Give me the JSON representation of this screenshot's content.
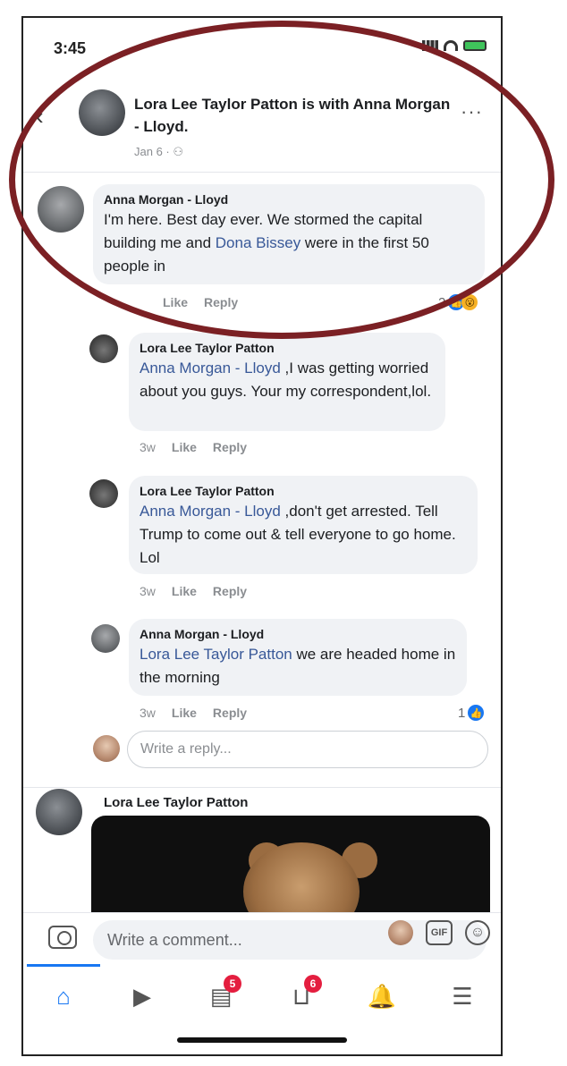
{
  "status_bar": {
    "time": "3:45"
  },
  "post": {
    "header_name": "Lora Lee Taylor Patton is with Anna Morgan - Lloyd.",
    "header_date": "Jan 6 · ⚇"
  },
  "comments": [
    {
      "author": "Anna Morgan - Lloyd",
      "text_before": "I'm here. Best day ever. We stormed the capital building me and ",
      "mention": "Dona Bissey",
      "text_after": " were in the first 50 people in",
      "time": "",
      "like_label": "Like",
      "reply_label": "Reply",
      "reaction_count": "2"
    },
    {
      "author": "Lora Lee Taylor Patton",
      "mention": "Anna Morgan - Lloyd",
      "text_after": " ,I was getting worried about you guys. Your my correspondent,lol.",
      "time": "3w",
      "like_label": "Like",
      "reply_label": "Reply"
    },
    {
      "author": "Lora Lee Taylor Patton",
      "mention": "Anna Morgan - Lloyd",
      "text_after": " ,don't get arrested.  Tell Trump to come out & tell everyone to go home. Lol",
      "time": "3w",
      "like_label": "Like",
      "reply_label": "Reply"
    },
    {
      "author": "Anna Morgan - Lloyd",
      "mention": "Lora Lee Taylor Patton",
      "text_after": " we are headed home in the morning",
      "time": "3w",
      "like_label": "Like",
      "reply_label": "Reply",
      "reaction_count": "1"
    }
  ],
  "reply_input": {
    "placeholder": "Write a reply..."
  },
  "next_post": {
    "author": "Lora Lee Taylor Patton"
  },
  "composer": {
    "placeholder": "Write a comment...",
    "gif_label": "GIF"
  },
  "tabbar": {
    "badges": {
      "pages": "5",
      "marketplace": "6"
    }
  },
  "colors": {
    "accent": "#1877f2",
    "annotation": "#7b2024",
    "badge": "#e41e3f"
  }
}
